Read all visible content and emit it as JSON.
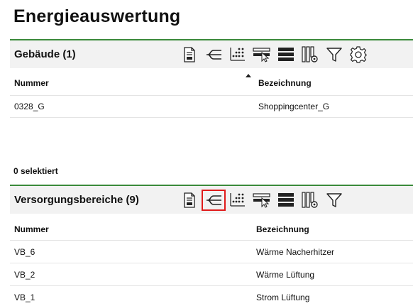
{
  "page": {
    "title": "Energieauswertung"
  },
  "buildings": {
    "title": "Gebäude (1)",
    "columns": {
      "number": "Nummer",
      "name": "Bezeichnung"
    },
    "rows": [
      {
        "number": "0328_G",
        "name": "Shoppingcenter_G"
      }
    ],
    "selected_label": "0 selektiert"
  },
  "supply": {
    "title": "Versorgungsbereiche (9)",
    "columns": {
      "number": "Nummer",
      "name": "Bezeichnung"
    },
    "rows": [
      {
        "number": "VB_6",
        "name": "Wärme Nacherhitzer"
      },
      {
        "number": "VB_2",
        "name": "Wärme Lüftung"
      },
      {
        "number": "VB_1",
        "name": "Strom Lüftung"
      }
    ]
  },
  "toolbar_icons": [
    "report-icon",
    "tree-icon",
    "dot-matrix-icon",
    "row-select-icon",
    "rows-icon",
    "column-settings-icon",
    "filter-icon",
    "gear-icon"
  ],
  "colors": {
    "accent": "#3a8a3a",
    "highlight": "#e01b1b"
  }
}
